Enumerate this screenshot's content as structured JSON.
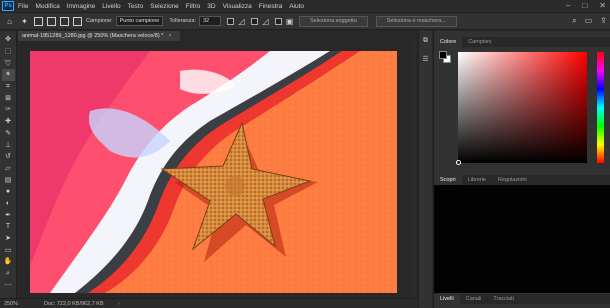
{
  "menubar": {
    "logo": "Ps",
    "items": [
      "File",
      "Modifica",
      "Immagine",
      "Livello",
      "Testo",
      "Selezione",
      "Filtro",
      "3D",
      "Visualizza",
      "Finestra",
      "Aiuto"
    ],
    "window_controls": [
      "–",
      "□",
      "✕"
    ]
  },
  "options": {
    "campione_label": "Campione:",
    "campione_value": "Punto campione",
    "tolleranza_label": "Tolleranza:",
    "tolleranza_value": "32",
    "select_subject": "Seleziona soggetto",
    "select_mask": "Seleziona e maschera..."
  },
  "document": {
    "tab_title": "animal-1851289_1280.jpg @ 250% (Maschera veloce/8) *",
    "close": "×"
  },
  "status": {
    "zoom": "250%",
    "doc": "Doc: 722,0 KB/962,7 KB",
    "arrow": "›"
  },
  "panels": {
    "color_tabs": [
      "Colore",
      "Campioni"
    ],
    "styles_tabs": [
      "Scopri",
      "Librerie",
      "Regolazioni"
    ],
    "layers_tabs": [
      "Livelli",
      "Canali",
      "Tracciati"
    ]
  },
  "colors": {
    "accent": "#31a8ff",
    "sand": "#ff7d42",
    "mask_red": "#ff3050"
  },
  "tools": [
    "move-icon",
    "marquee-icon",
    "lasso-icon",
    "magic-wand-icon",
    "crop-icon",
    "frame-icon",
    "eyedropper-icon",
    "healing-icon",
    "brush-icon",
    "stamp-icon",
    "history-brush-icon",
    "eraser-icon",
    "gradient-icon",
    "blur-icon",
    "dodge-icon",
    "pen-icon",
    "type-icon",
    "path-select-icon",
    "shape-icon",
    "hand-icon",
    "zoom-icon"
  ]
}
